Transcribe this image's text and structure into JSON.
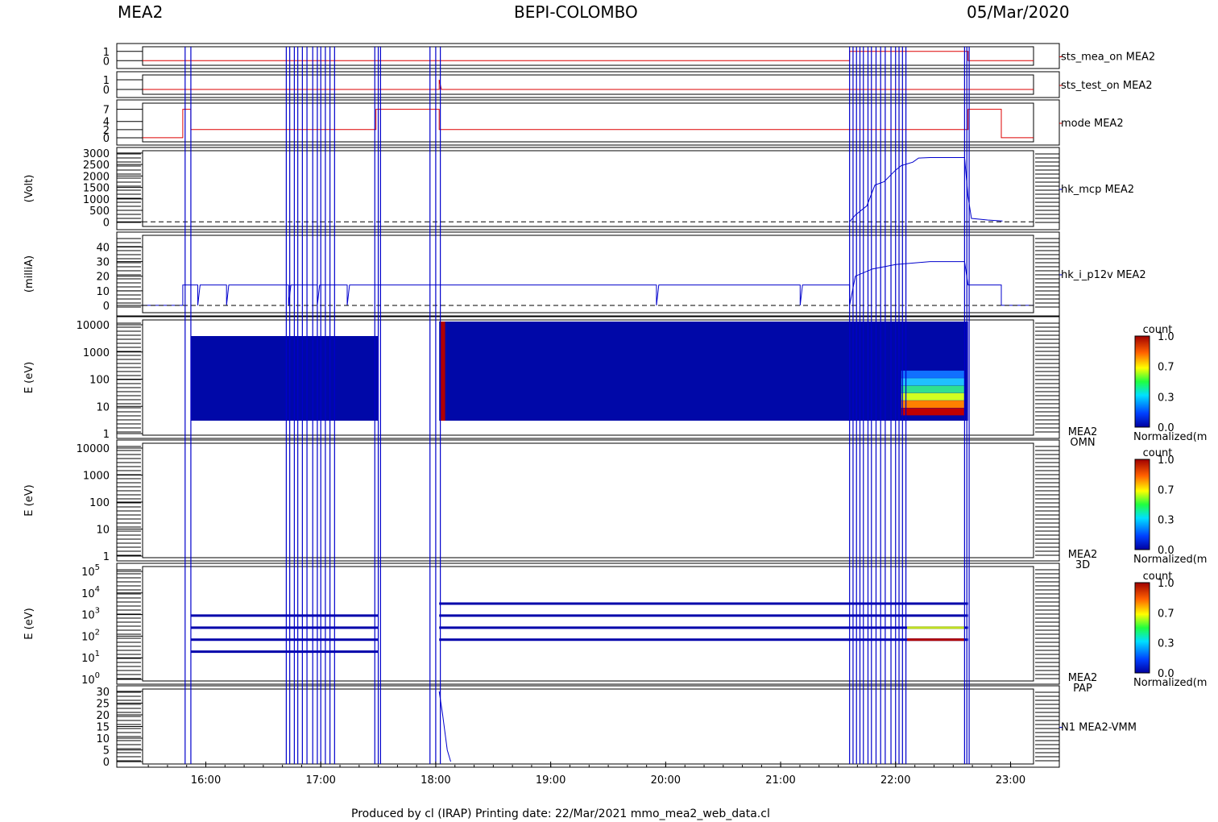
{
  "header": {
    "left": "MEA2",
    "center": "BEPI-COLOMBO",
    "right": "05/Mar/2020"
  },
  "footer": "Produced by cl (IRAP)    Printing date: 22/Mar/2021    mmo_mea2_web_data.cl",
  "colors": {
    "red": "#dd0000",
    "blue": "#0000cc",
    "dark_blue": "#0000aa",
    "spec_bg": "#0008a8"
  },
  "chart_data": {
    "type": "line",
    "x_unit": "UT hour",
    "xlim": [
      15.45,
      23.2
    ],
    "x_ticks": [
      "16:00",
      "17:00",
      "18:00",
      "19:00",
      "20:00",
      "21:00",
      "22:00",
      "23:00"
    ],
    "x_tick_values": [
      16,
      17,
      18,
      19,
      20,
      21,
      22,
      23
    ],
    "event_lines": [
      15.82,
      15.87,
      16.7,
      16.73,
      16.77,
      16.8,
      16.84,
      16.88,
      16.93,
      16.97,
      17.0,
      17.04,
      17.08,
      17.12,
      17.47,
      17.5,
      17.52,
      17.95,
      18.0,
      18.04,
      21.6,
      21.63,
      21.66,
      21.69,
      21.72,
      21.76,
      21.79,
      21.83,
      21.87,
      21.91,
      21.96,
      22.0,
      22.03,
      22.06,
      22.09,
      22.6,
      22.62,
      22.64
    ],
    "panels": [
      {
        "name": "sts_mea_on MEA2",
        "color": "#dd0000",
        "ylabel": "",
        "ylim": [
          -0.5,
          1.5
        ],
        "ticks": [
          "1",
          "0"
        ],
        "tick_values": [
          1,
          0
        ],
        "series": [
          [
            15.45,
            0
          ],
          [
            21.6,
            0
          ],
          [
            21.6,
            1
          ],
          [
            22.63,
            1
          ],
          [
            22.63,
            0
          ],
          [
            23.2,
            0
          ]
        ]
      },
      {
        "name": "sts_test_on MEA2",
        "color": "#dd0000",
        "ylabel": "",
        "ylim": [
          -0.5,
          1.5
        ],
        "ticks": [
          "1",
          "0"
        ],
        "tick_values": [
          1,
          0
        ],
        "series": [
          [
            15.45,
            0
          ],
          [
            18.03,
            0
          ],
          [
            18.03,
            1
          ],
          [
            18.05,
            0
          ],
          [
            23.2,
            0
          ]
        ]
      },
      {
        "name": "mode MEA2",
        "color": "#dd0000",
        "ylabel": "",
        "ylim": [
          -1,
          8.5
        ],
        "ticks": [
          "7",
          "4",
          "2",
          "0"
        ],
        "tick_values": [
          7,
          4,
          2,
          0
        ],
        "series": [
          [
            15.45,
            0
          ],
          [
            15.8,
            0
          ],
          [
            15.8,
            7
          ],
          [
            15.87,
            7
          ],
          [
            15.87,
            2
          ],
          [
            17.48,
            2
          ],
          [
            17.48,
            7
          ],
          [
            18.03,
            7
          ],
          [
            18.03,
            2
          ],
          [
            22.63,
            2
          ],
          [
            22.63,
            7
          ],
          [
            22.92,
            7
          ],
          [
            22.92,
            0
          ],
          [
            23.2,
            0
          ]
        ]
      },
      {
        "name": "hk_mcp MEA2",
        "color": "#0000cc",
        "ylabel": "(Volt)",
        "ylim": [
          -200,
          3100
        ],
        "ticks": [
          "3000",
          "2500",
          "2000",
          "1500",
          "1000",
          "500",
          "0"
        ],
        "tick_values": [
          3000,
          2500,
          2000,
          1500,
          1000,
          500,
          0
        ],
        "series": [
          [
            21.6,
            0
          ],
          [
            21.65,
            300
          ],
          [
            21.75,
            700
          ],
          [
            21.82,
            1600
          ],
          [
            21.9,
            1750
          ],
          [
            22.0,
            2250
          ],
          [
            22.05,
            2450
          ],
          [
            22.15,
            2600
          ],
          [
            22.2,
            2780
          ],
          [
            22.3,
            2800
          ],
          [
            22.6,
            2800
          ],
          [
            22.63,
            1100
          ],
          [
            22.66,
            150
          ],
          [
            22.8,
            80
          ],
          [
            22.93,
            40
          ]
        ]
      },
      {
        "name": "hk_i_p12v MEA2",
        "color": "#0000cc",
        "ylabel": "(milliA)",
        "ylim": [
          -5,
          48
        ],
        "ticks": [
          "40",
          "30",
          "20",
          "10",
          "0"
        ],
        "tick_values": [
          40,
          30,
          20,
          10,
          0
        ],
        "series": [
          [
            15.45,
            0
          ],
          [
            15.8,
            0
          ],
          [
            15.8,
            14
          ],
          [
            15.93,
            14
          ],
          [
            15.93,
            0
          ],
          [
            15.95,
            14
          ],
          [
            16.18,
            14
          ],
          [
            16.18,
            0
          ],
          [
            16.2,
            14
          ],
          [
            16.72,
            14
          ],
          [
            16.72,
            0
          ],
          [
            16.74,
            14
          ],
          [
            16.97,
            14
          ],
          [
            16.97,
            0
          ],
          [
            16.99,
            14
          ],
          [
            17.23,
            14
          ],
          [
            17.23,
            0
          ],
          [
            17.25,
            14
          ],
          [
            19.92,
            14
          ],
          [
            19.92,
            0
          ],
          [
            19.94,
            14
          ],
          [
            21.17,
            14
          ],
          [
            21.17,
            0
          ],
          [
            21.19,
            14
          ],
          [
            21.6,
            14
          ],
          [
            21.6,
            0
          ],
          [
            21.65,
            20
          ],
          [
            21.8,
            25
          ],
          [
            22.0,
            28
          ],
          [
            22.3,
            30
          ],
          [
            22.6,
            30
          ],
          [
            22.63,
            14
          ],
          [
            22.92,
            14
          ],
          [
            22.92,
            0
          ],
          [
            23.2,
            0
          ]
        ]
      },
      {
        "name": "MEA2 OMN",
        "ylabel": "E (eV)",
        "type": "spectrogram",
        "ticks": [
          "10000",
          "1000",
          "100",
          "10",
          "1"
        ],
        "cbar_title": "count",
        "cbar_ticks": [
          "1.0",
          "0.7",
          "0.3",
          "0.0"
        ],
        "cbar_label": "Normalized(m"
      },
      {
        "name": "MEA2 3D",
        "ylabel": "E (eV)",
        "type": "spectrogram",
        "ticks": [
          "10000",
          "1000",
          "100",
          "10",
          "1"
        ],
        "cbar_title": "count",
        "cbar_ticks": [
          "1.0",
          "0.7",
          "0.3",
          "0.0"
        ],
        "cbar_label": "Normalized(m"
      },
      {
        "name": "MEA2 PAP",
        "ylabel": "E (eV)",
        "type": "spectrogram",
        "ticks": [
          "10",
          "10",
          "10",
          "10",
          "10",
          "10"
        ],
        "tick_exponents": [
          "5",
          "4",
          "3",
          "2",
          "1",
          "0"
        ],
        "cbar_title": "count",
        "cbar_ticks": [
          "1.0",
          "0.7",
          "0.3",
          "0.0"
        ],
        "cbar_label": "Normalized(m"
      },
      {
        "name": "N1 MEA2-VMM",
        "color": "#0000cc",
        "ylabel": "",
        "ylim": [
          -1,
          31
        ],
        "ticks": [
          "30",
          "25",
          "20",
          "15",
          "10",
          "5",
          "0"
        ],
        "tick_values": [
          30,
          25,
          20,
          15,
          10,
          5,
          0
        ],
        "series": [
          [
            18.03,
            30
          ],
          [
            18.06,
            20
          ],
          [
            18.1,
            5
          ],
          [
            18.13,
            0
          ]
        ]
      }
    ]
  }
}
